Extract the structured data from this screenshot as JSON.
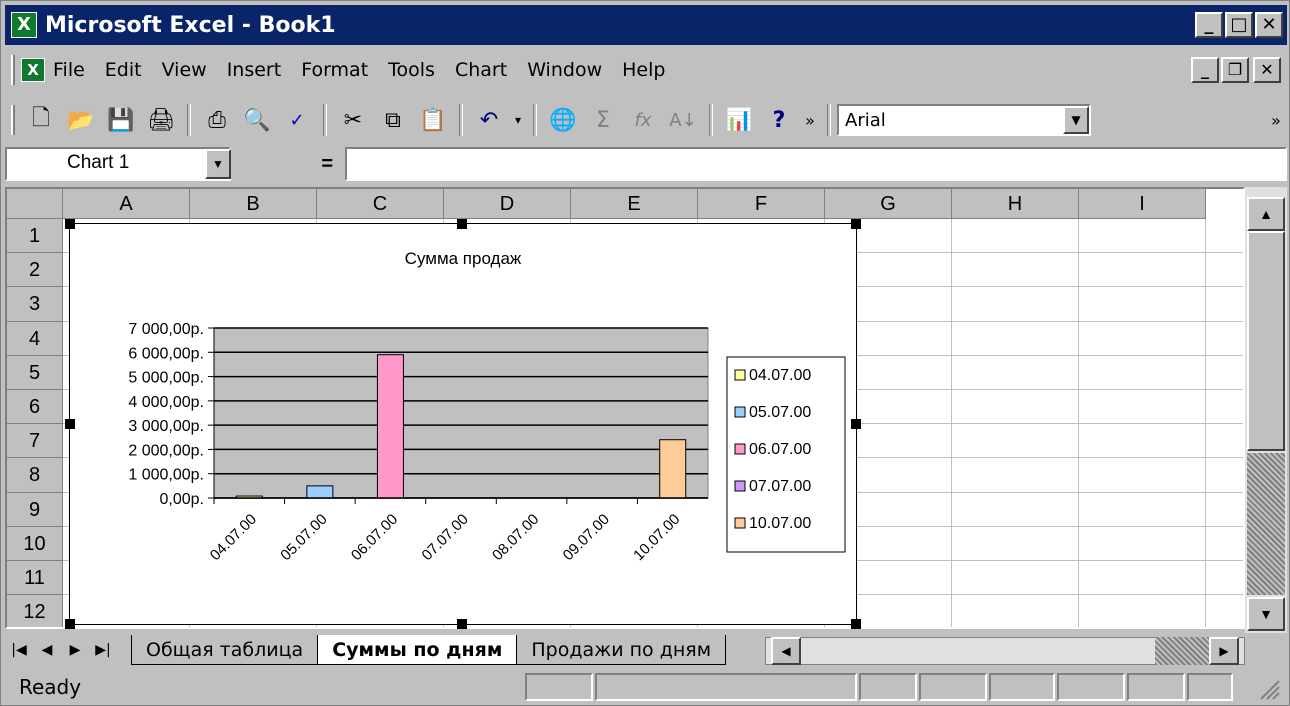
{
  "window": {
    "title": "Microsoft Excel - Book1"
  },
  "menus": [
    "File",
    "Edit",
    "View",
    "Insert",
    "Format",
    "Tools",
    "Chart",
    "Window",
    "Help"
  ],
  "toolbar": {
    "font_name": "Arial"
  },
  "namebox": {
    "value": "Chart 1",
    "equals": "="
  },
  "columns": [
    "A",
    "B",
    "C",
    "D",
    "E",
    "F",
    "G",
    "H",
    "I"
  ],
  "rows": [
    "1",
    "2",
    "3",
    "4",
    "5",
    "6",
    "7",
    "8",
    "9",
    "10",
    "11",
    "12"
  ],
  "sheet_tabs": [
    {
      "label": "Общая таблица",
      "active": false
    },
    {
      "label": "Суммы по дням",
      "active": true
    },
    {
      "label": "Продажи по дням",
      "active": false
    }
  ],
  "status": {
    "text": "Ready"
  },
  "chart_data": {
    "type": "bar",
    "title": "Сумма продаж",
    "categories": [
      "04.07.00",
      "05.07.00",
      "06.07.00",
      "07.07.00",
      "08.07.00",
      "09.07.00",
      "10.07.00"
    ],
    "series": [
      {
        "name": "04.07.00",
        "color": "#ffff99",
        "values": [
          80,
          0,
          0,
          0,
          0,
          0,
          0
        ]
      },
      {
        "name": "05.07.00",
        "color": "#99ccff",
        "values": [
          0,
          500,
          0,
          0,
          0,
          0,
          0
        ]
      },
      {
        "name": "06.07.00",
        "color": "#ff99cc",
        "values": [
          0,
          0,
          5900,
          0,
          0,
          0,
          0
        ]
      },
      {
        "name": "07.07.00",
        "color": "#cc99ff",
        "values": [
          0,
          0,
          0,
          0,
          0,
          0,
          0
        ]
      },
      {
        "name": "10.07.00",
        "color": "#ffcc99",
        "values": [
          0,
          0,
          0,
          0,
          0,
          0,
          2400
        ]
      }
    ],
    "yticks": [
      "0,00р.",
      "1 000,00р.",
      "2 000,00р.",
      "3 000,00р.",
      "4 000,00р.",
      "5 000,00р.",
      "6 000,00р.",
      "7 000,00р."
    ],
    "ylim": [
      0,
      7000
    ],
    "plot_bg": "#c0c0c0",
    "legend": "right",
    "grid": true
  }
}
